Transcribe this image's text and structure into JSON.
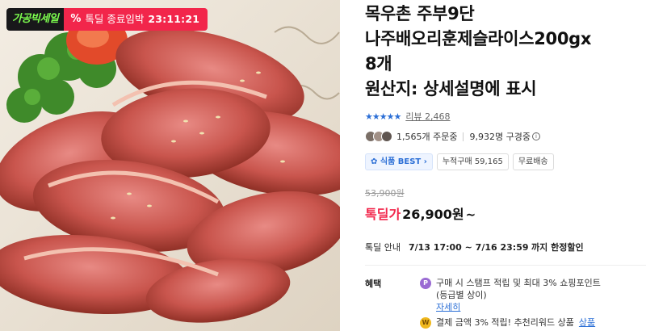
{
  "badges": {
    "brand": "가공빅세일",
    "deal_icon": "%",
    "deal_text": "톡딜 종료임박",
    "timer": "23:11:21"
  },
  "image": {
    "subject": "sliced smoked duck with parsley and tomato"
  },
  "product": {
    "title_lines": [
      "목우촌 주부9단",
      "나주배오리훈제슬라이스200gx",
      "8개",
      "원산지: 상세설명에 표시"
    ],
    "stars": "★★★★★",
    "review_label": "리뷰",
    "review_count": "2,468",
    "orders": "1,565개 주문중",
    "watching": "9,932명 구경중",
    "tags": [
      "식품 BEST",
      "누적구매 59,165",
      "무료배송"
    ],
    "original_price": "53,900원",
    "price_label": "톡딜가",
    "price": "26,900원",
    "price_suffix": "~",
    "deal_label": "톡딜 안내",
    "deal_period": "7/13 17:00 ~ 7/16 23:59",
    "deal_suffix": "까지 한정할인",
    "benefits_label": "혜택",
    "benefit1_line1": "구매 시 스탬프 적립 및 최대 3% 쇼핑포인트",
    "benefit1_line2": "(등급별 상이)",
    "benefit1_link": "자세히",
    "benefit2_text": "결제 금액 3% 적립! 추천리워드 상품",
    "benefit2_link": "상품"
  },
  "colors": {
    "deal_red": "#f2264b",
    "link_blue": "#2c6fd6",
    "brand_green": "#7dff4f"
  }
}
